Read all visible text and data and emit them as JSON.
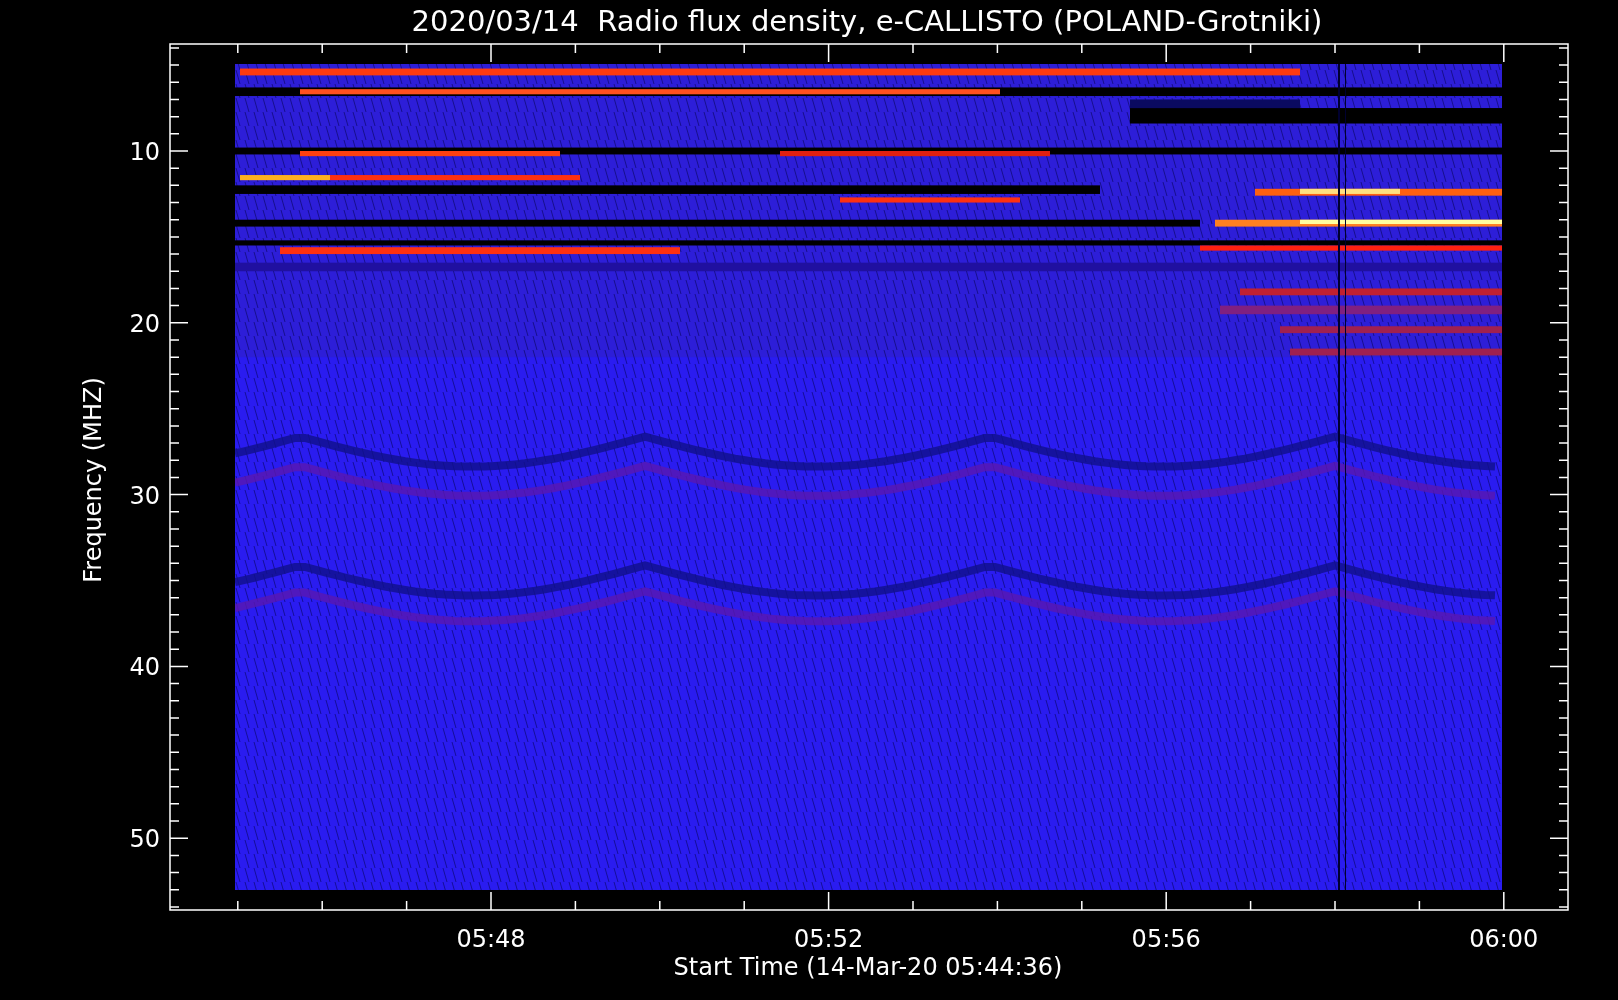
{
  "plot": {
    "title": "2020/03/14  Radio flux density, e-CALLISTO (POLAND-Grotniki)",
    "xlabel": "Start Time (14-Mar-20 05:44:36)",
    "ylabel": "Frequency (MHZ)",
    "xticks": [
      "05:48",
      "05:52",
      "05:56",
      "06:00"
    ],
    "yticks": [
      "10",
      "20",
      "30",
      "40",
      "50"
    ]
  }
}
